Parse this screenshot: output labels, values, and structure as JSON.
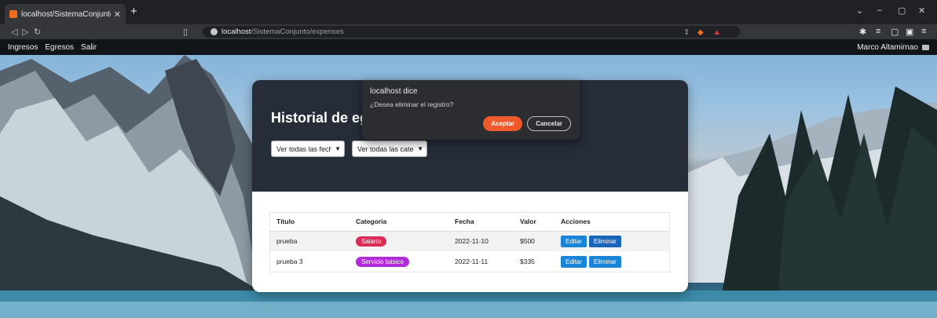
{
  "browser": {
    "tab_title": "localhost/SistemaConjunto/expe",
    "url_host": "localhost",
    "url_path": "/SistemaConjunto/expenses",
    "accent": "#f06a1d"
  },
  "nav": {
    "items": [
      "Ingresos",
      "Egresos",
      "Salir"
    ],
    "user": "Marco Altamirnao"
  },
  "page": {
    "title": "Historial de egresos",
    "filter_date": "Ver todas las fechas",
    "filter_category": "Ver todas las categ"
  },
  "table": {
    "headers": [
      "Título",
      "Categoria",
      "Fecha",
      "Valor",
      "Acciones"
    ],
    "rows": [
      {
        "title": "prueba",
        "category": "Salario",
        "category_color": "#dc2c55",
        "date": "2022-11-10",
        "value": "$500"
      },
      {
        "title": "prueba 3",
        "category": "Servicio básico",
        "category_color": "#b22bd8",
        "date": "2022-11-11",
        "value": "$335"
      }
    ],
    "edit_label": "Editar",
    "delete_label": "Eliminar"
  },
  "dialog": {
    "title": "localhost dice",
    "message": "¿Desea eliminar el registro?",
    "ok": "Aceptar",
    "cancel": "Cancelar"
  }
}
